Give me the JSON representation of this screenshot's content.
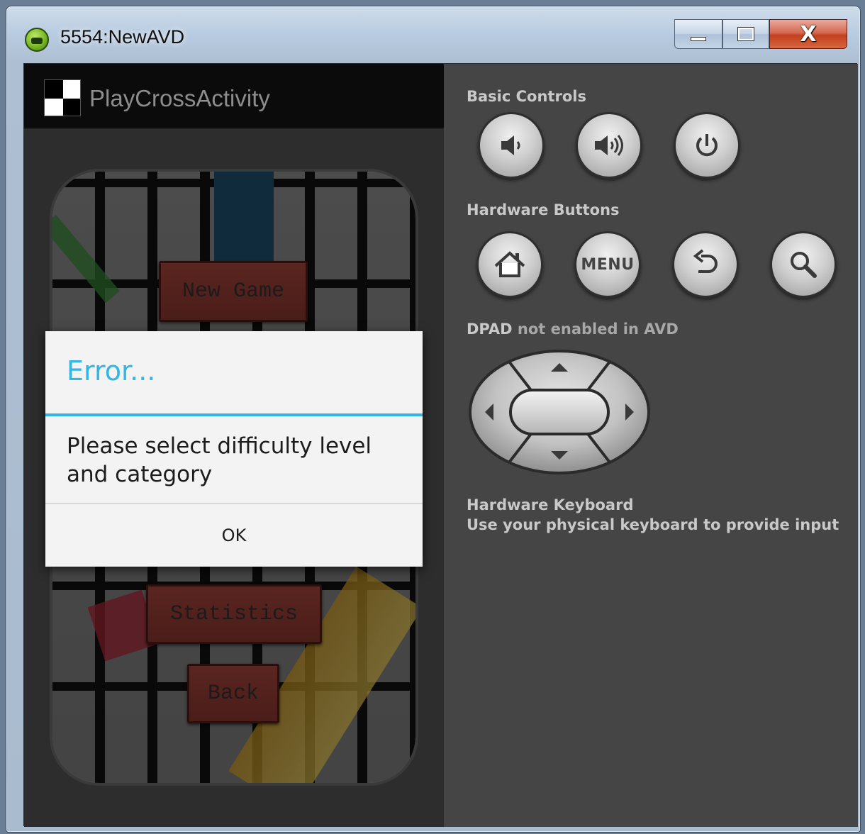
{
  "window": {
    "title": "5554:NewAVD",
    "controls": {
      "minimize": "minimize",
      "maximize": "maximize",
      "close": "X"
    }
  },
  "app": {
    "activity_title": "PlayCrossActivity",
    "buttons": {
      "new_game": "New Game",
      "statistics": "Statistics",
      "back": "Back"
    }
  },
  "dialog": {
    "title": "Error...",
    "message": "Please select difficulty level and category",
    "ok_label": "OK"
  },
  "controls": {
    "basic_label": "Basic Controls",
    "hardware_label": "Hardware Buttons",
    "dpad_label_strong": "DPAD",
    "dpad_label_rest": " not enabled in AVD",
    "menu_label": "MENU",
    "keyboard_title": "Hardware Keyboard",
    "keyboard_hint": "Use your physical keyboard to provide input",
    "icons": [
      "volume-down-icon",
      "volume-up-icon",
      "power-icon",
      "home-icon",
      "back-icon",
      "search-icon"
    ]
  },
  "colors": {
    "holo_blue": "#33b5e5",
    "panel_bg": "#454545",
    "game_button": "#4a1d19"
  }
}
